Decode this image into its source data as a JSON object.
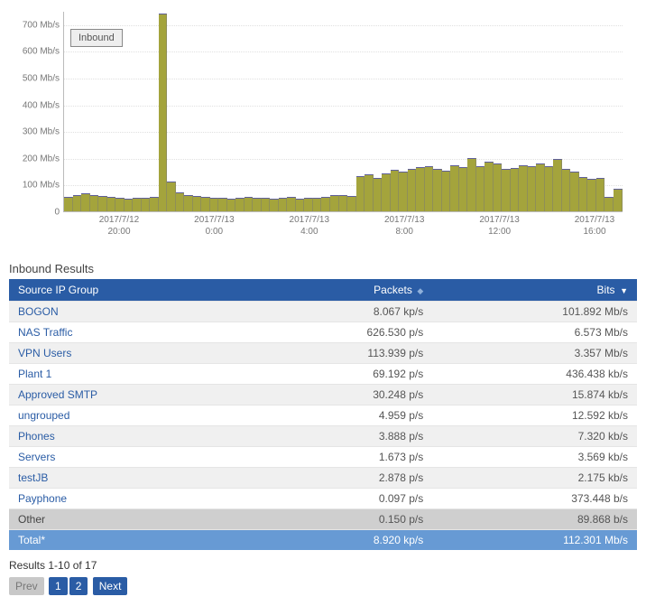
{
  "chart_data": {
    "type": "bar",
    "title": "",
    "legend": "Inbound",
    "ylabel": "Mb/s",
    "ylim": [
      0,
      750
    ],
    "y_ticks": [
      0,
      100,
      200,
      300,
      400,
      500,
      600,
      700
    ],
    "y_tick_labels": [
      "0",
      "100 Mb/s",
      "200 Mb/s",
      "300 Mb/s",
      "400 Mb/s",
      "500 Mb/s",
      "600 Mb/s",
      "700 Mb/s"
    ],
    "x_tick_labels": [
      "2017/7/12\n20:00",
      "2017/7/13\n0:00",
      "2017/7/13\n4:00",
      "2017/7/13\n8:00",
      "2017/7/13\n12:00",
      "2017/7/13\n16:00"
    ],
    "x_tick_positions_pct": [
      10,
      27,
      44,
      61,
      78,
      95
    ],
    "values": [
      55,
      60,
      68,
      62,
      58,
      55,
      50,
      48,
      52,
      50,
      55,
      740,
      110,
      70,
      60,
      58,
      55,
      50,
      52,
      48,
      50,
      55,
      50,
      52,
      48,
      50,
      55,
      48,
      50,
      52,
      55,
      60,
      62,
      58,
      132,
      138,
      125,
      142,
      155,
      148,
      160,
      165,
      170,
      160,
      152,
      172,
      165,
      198,
      170,
      185,
      180,
      158,
      162,
      172,
      168,
      180,
      170,
      195,
      158,
      150,
      130,
      120,
      125,
      55,
      85
    ]
  },
  "results_title": "Inbound Results",
  "columns": {
    "source": "Source IP Group",
    "packets": "Packets",
    "bits": "Bits"
  },
  "rows": [
    {
      "name": "BOGON",
      "packets": "8.067 kp/s",
      "bits": "101.892 Mb/s"
    },
    {
      "name": "NAS Traffic",
      "packets": "626.530 p/s",
      "bits": "6.573 Mb/s"
    },
    {
      "name": "VPN Users",
      "packets": "113.939 p/s",
      "bits": "3.357 Mb/s"
    },
    {
      "name": "Plant 1",
      "packets": "69.192 p/s",
      "bits": "436.438 kb/s"
    },
    {
      "name": "Approved SMTP",
      "packets": "30.248 p/s",
      "bits": "15.874 kb/s"
    },
    {
      "name": "ungrouped",
      "packets": "4.959 p/s",
      "bits": "12.592 kb/s"
    },
    {
      "name": "Phones",
      "packets": "3.888 p/s",
      "bits": "7.320 kb/s"
    },
    {
      "name": "Servers",
      "packets": "1.673 p/s",
      "bits": "3.569 kb/s"
    },
    {
      "name": "testJB",
      "packets": "2.878 p/s",
      "bits": "2.175 kb/s"
    },
    {
      "name": "Payphone",
      "packets": "0.097 p/s",
      "bits": "373.448 b/s"
    }
  ],
  "other": {
    "name": "Other",
    "packets": "0.150 p/s",
    "bits": "89.868 b/s"
  },
  "total": {
    "name": "Total*",
    "packets": "8.920 kp/s",
    "bits": "112.301 Mb/s"
  },
  "results_count": "Results 1-10 of 17",
  "pager": {
    "prev": "Prev",
    "next": "Next",
    "pages": [
      "1",
      "2"
    ],
    "current": 1
  }
}
